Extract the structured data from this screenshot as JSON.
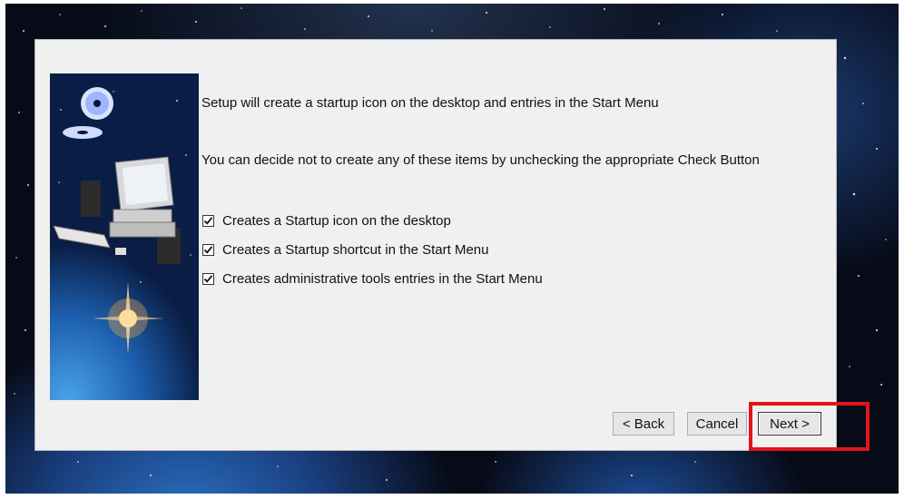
{
  "wizard": {
    "intro": "Setup will create a startup icon on the desktop and entries in the Start Menu",
    "instruction": "You can decide not to create any of these items by unchecking the appropriate Check Button",
    "options": [
      {
        "label": "Creates a Startup icon on the desktop",
        "checked": true
      },
      {
        "label": "Creates a Startup shortcut in the Start Menu",
        "checked": true
      },
      {
        "label": "Creates administrative tools entries in the Start Menu",
        "checked": true
      }
    ],
    "buttons": {
      "back": "< Back",
      "cancel": "Cancel",
      "next": "Next >"
    }
  },
  "colors": {
    "highlight": "#e3141b",
    "dialog_bg": "#f0f0f0"
  }
}
